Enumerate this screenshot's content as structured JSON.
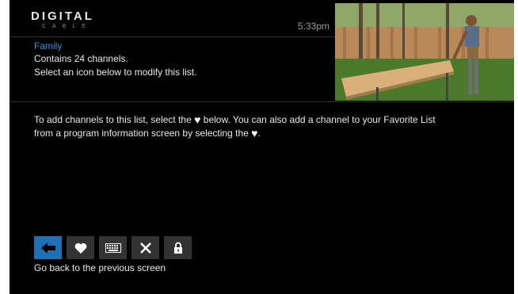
{
  "brand": {
    "name": "DIGITAL",
    "sub": "CABLE"
  },
  "clock": "5:33pm",
  "list": {
    "name": "Family",
    "channel_count_text": "Contains 24 channels.",
    "hint": "Select an icon below to modify this list."
  },
  "instructions": {
    "line1_a": "To add channels to this list, select the",
    "line1_b": "below. You can also add a channel to your Favorite List",
    "line2_a": "from a program information screen by selecting the",
    "line2_b": "."
  },
  "toolbar": {
    "buttons": [
      {
        "icon": "arrow-left-icon",
        "active": true
      },
      {
        "icon": "heart-icon",
        "active": false
      },
      {
        "icon": "keyboard-icon",
        "active": false
      },
      {
        "icon": "close-icon",
        "active": false
      },
      {
        "icon": "lock-icon",
        "active": false
      }
    ]
  },
  "status_text": "Go back to the previous screen",
  "colors": {
    "background": "#000000",
    "accent": "#3b8fd9",
    "active_button": "#1f6fb5",
    "button": "#333333"
  }
}
